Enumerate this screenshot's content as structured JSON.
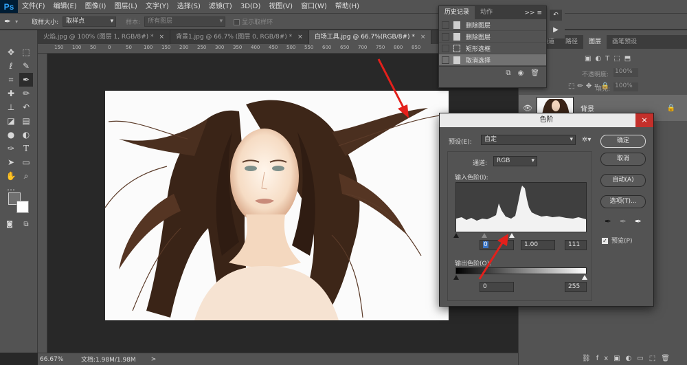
{
  "menu": {
    "logo": "Ps",
    "items": [
      "文件(F)",
      "编辑(E)",
      "图像(I)",
      "图层(L)",
      "文字(Y)",
      "选择(S)",
      "滤镜(T)",
      "3D(D)",
      "视图(V)",
      "窗口(W)",
      "帮助(H)"
    ]
  },
  "options": {
    "sample_size_label": "取样大小:",
    "sample_size_value": "取样点",
    "sample_label": "样本:",
    "sample_value": "所有图层",
    "show_ring_label": "显示取样环"
  },
  "tabs": [
    {
      "label": "火焰.jpg @ 100% (图层 1, RGB/8#) *",
      "close": "×"
    },
    {
      "label": "背景1.jpg @ 66.7% (图层 0, RGB/8#) *",
      "close": "×"
    },
    {
      "label": "白场工具.jpg @ 66.7%(RGB/8#) *",
      "close": "×"
    }
  ],
  "ruler_ticks": [
    "150",
    "100",
    "50",
    "0",
    "50",
    "100",
    "150",
    "200",
    "250",
    "300",
    "350",
    "400",
    "450",
    "500",
    "550",
    "600",
    "650",
    "700",
    "750",
    "800",
    "850"
  ],
  "status": {
    "zoom": "66.67%",
    "doc": "文档:1.98M/1.98M",
    "arrow": ">"
  },
  "history": {
    "tabs": [
      "历史记录",
      "动作"
    ],
    "menu_icons": ">>",
    "items": [
      "删除图层",
      "删除图层",
      "矩形选框",
      "取消选择"
    ],
    "active_index": 3
  },
  "layers": {
    "tabs": [
      "通道",
      "路径",
      "图层",
      "画笔预设"
    ],
    "opacity_label": "不透明度:",
    "opacity_value": "100%",
    "fill_label": "填充:",
    "fill_value": "100%",
    "layer_name": "背景"
  },
  "levels": {
    "title": "色阶",
    "close": "×",
    "preset_label": "预设(E):",
    "preset_value": "自定",
    "channel_label": "通道:",
    "channel_value": "RGB",
    "input_label": "输入色阶(I):",
    "input_black": "0",
    "input_gamma": "1.00",
    "input_white": "111",
    "output_label": "输出色阶(O):",
    "output_black": "0",
    "output_white": "255",
    "buttons": {
      "ok": "确定",
      "cancel": "取消",
      "auto": "自动(A)",
      "options": "选项(T)..."
    },
    "preview_label": "预览(P)",
    "preview_checked": true
  },
  "colors": {
    "accent_red": "#e3201b",
    "ps_blue": "#31a8ff"
  }
}
